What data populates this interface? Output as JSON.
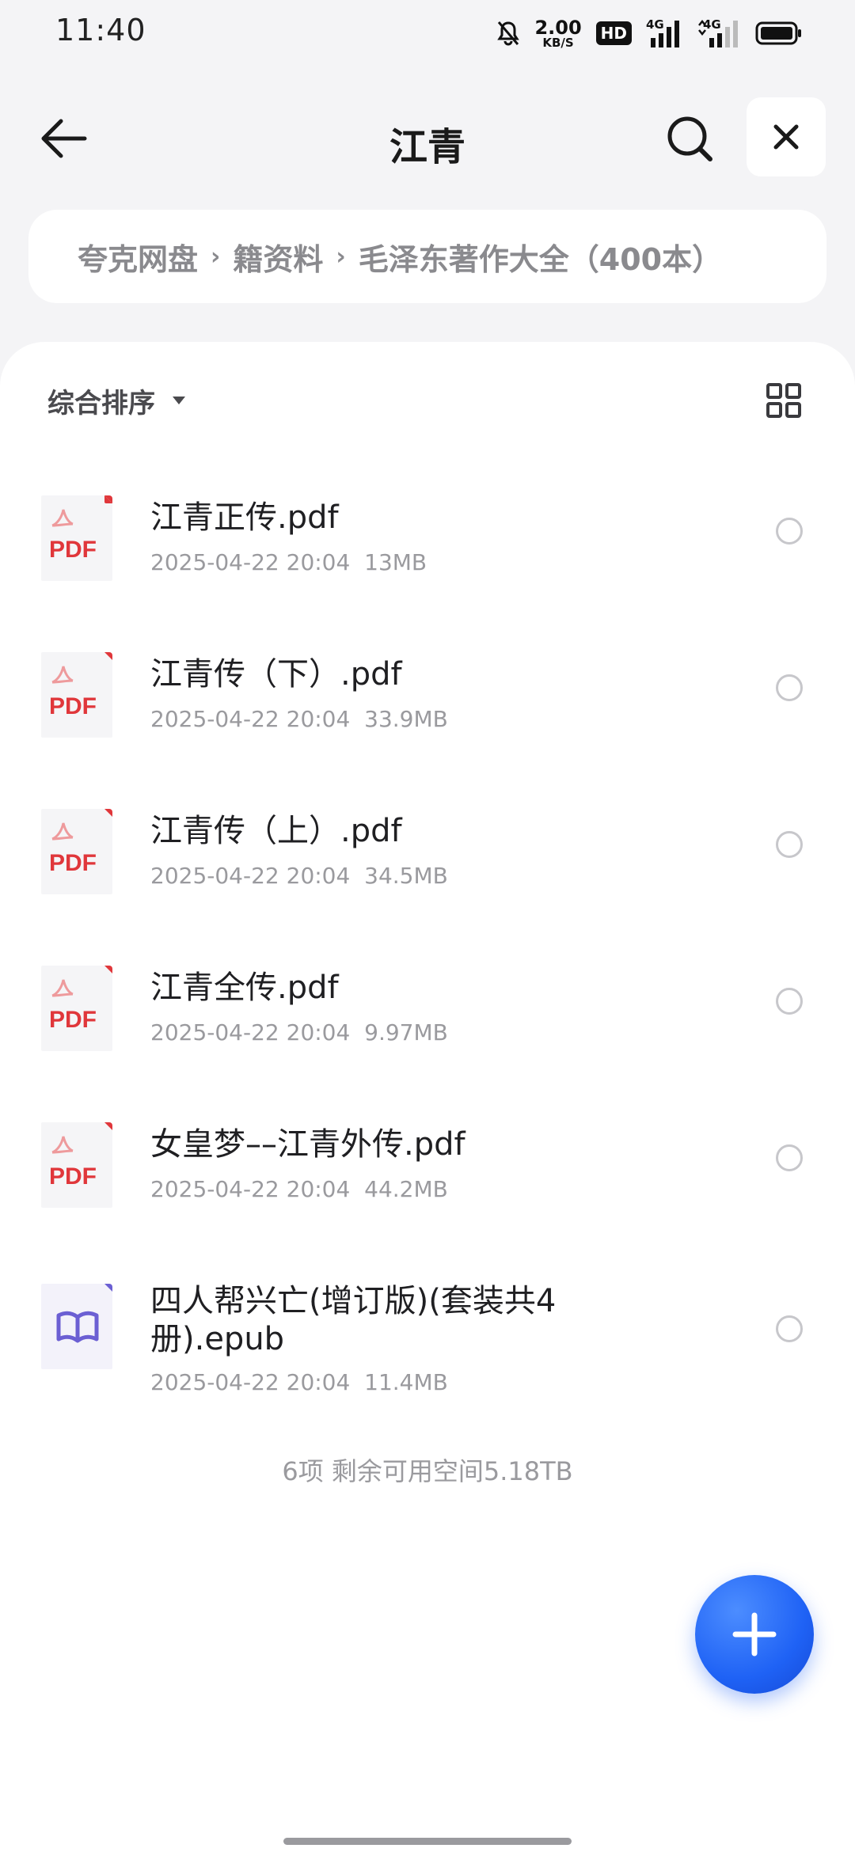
{
  "status_bar": {
    "time": "11:40",
    "speed_value": "2.00",
    "speed_unit": "KB/S",
    "hd_badge": "HD",
    "network_1": "4G",
    "network_2": "4G",
    "icons": [
      "bell-muted-icon",
      "hd-icon",
      "signal-icon",
      "signal-icon",
      "battery-icon"
    ]
  },
  "header": {
    "title": "江青"
  },
  "breadcrumb": [
    "夸克网盘",
    "籍资料",
    "毛泽东著作大全（400本）"
  ],
  "toolbar": {
    "sort_label": "综合排序"
  },
  "files": [
    {
      "name": "江青正传.pdf",
      "date": "2025-04-22 20:04",
      "size": "13MB",
      "type": "pdf"
    },
    {
      "name": "江青传（下）.pdf",
      "date": "2025-04-22 20:04",
      "size": "33.9MB",
      "type": "pdf"
    },
    {
      "name": "江青传（上）.pdf",
      "date": "2025-04-22 20:04",
      "size": "34.5MB",
      "type": "pdf"
    },
    {
      "name": "江青全传.pdf",
      "date": "2025-04-22 20:04",
      "size": "9.97MB",
      "type": "pdf"
    },
    {
      "name": "女皇梦––江青外传.pdf",
      "date": "2025-04-22 20:04",
      "size": "44.2MB",
      "type": "pdf"
    },
    {
      "name": "四人帮兴亡(增订版)(套装共4册).epub",
      "date": "2025-04-22 20:04",
      "size": "11.4MB",
      "type": "epub"
    }
  ],
  "file_icon_label": "PDF",
  "summary": "6项 剩余可用空间5.18TB",
  "colors": {
    "accent": "#1f62f5",
    "pdf_red": "#e0373b",
    "epub_purple": "#6b5fd3",
    "background": "#f4f4f6"
  }
}
